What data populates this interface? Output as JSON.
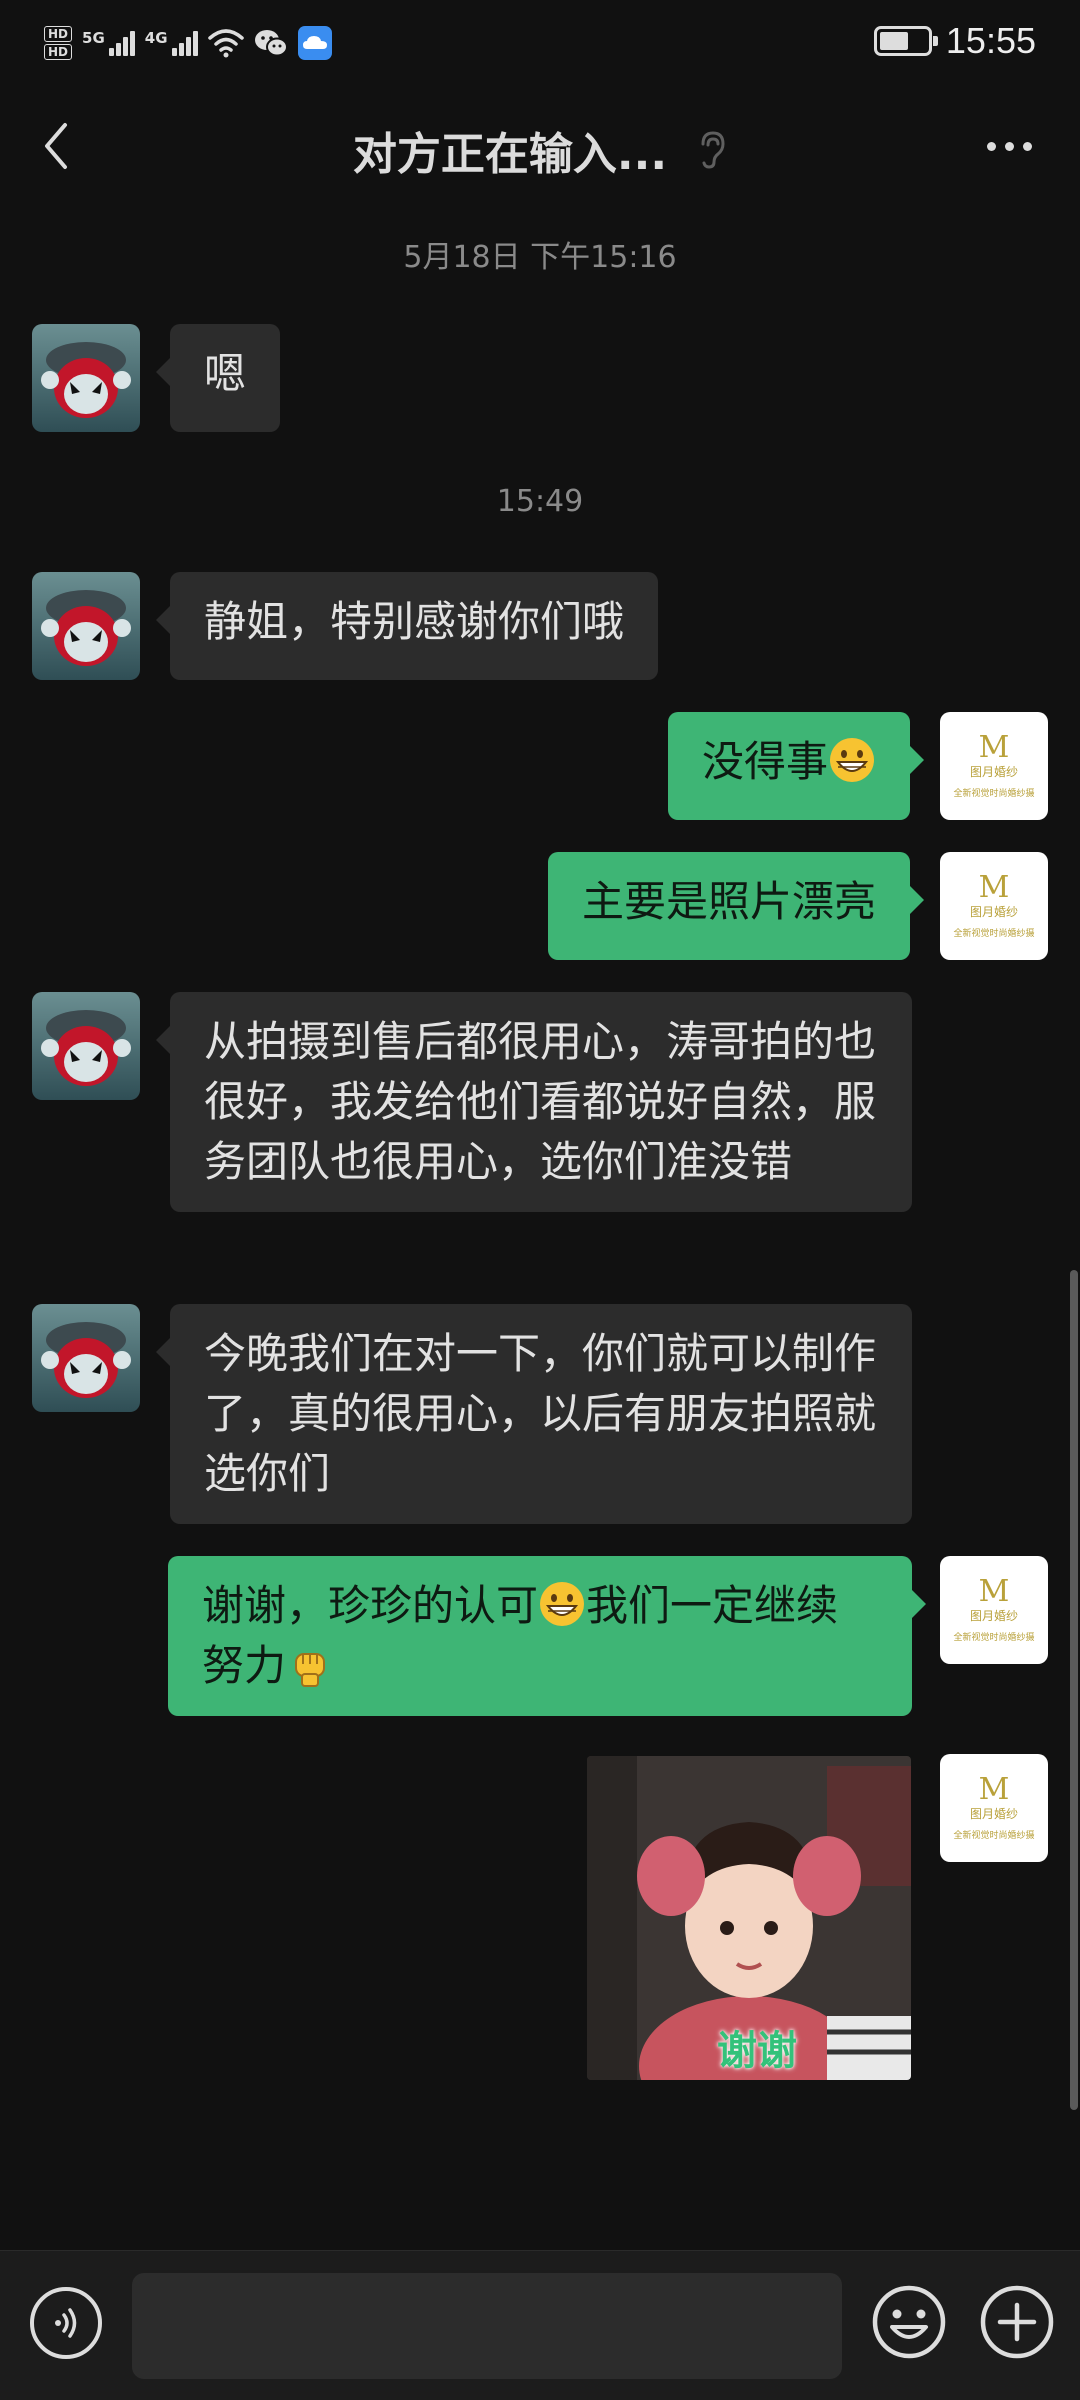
{
  "status_bar": {
    "hd_top": "HD",
    "hd_bottom": "HD",
    "net1_label": "5G",
    "net2_label": "4G",
    "time": "15:55",
    "battery_level": 0.6
  },
  "header": {
    "title": "对方正在输入..."
  },
  "chat": {
    "timestamp_1": "5月18日 下午15:16",
    "timestamp_2": "15:49",
    "messages": [
      {
        "side": "in",
        "text": "嗯"
      },
      {
        "side": "in",
        "text": "静姐，特别感谢你们哦"
      },
      {
        "side": "out",
        "text": "没得事",
        "emoji": "grinning-face"
      },
      {
        "side": "out",
        "text": "主要是照片漂亮"
      },
      {
        "side": "in",
        "text": "从拍摄到售后都很用心，涛哥拍的也很好，我发给他们看都说好自然，服务团队也很用心，选你们准没错"
      },
      {
        "side": "in",
        "text": "今晚我们在对一下，你们就可以制作了，真的很用心，以后有朋友拍照就选你们"
      },
      {
        "side": "out",
        "text_a": "谢谢，珍珍的认可",
        "emoji_a": "grinning-face",
        "text_b": "我们一定继续努力",
        "emoji_b": "raised-fist"
      },
      {
        "side": "out",
        "type": "sticker",
        "caption": "谢谢"
      }
    ]
  },
  "avatars": {
    "self_logo_text": "M",
    "self_brand": "图月婚纱",
    "self_tagline": "全新视觉时尚婚纱摄"
  },
  "colors": {
    "background": "#111111",
    "bubble_in": "#2c2c2c",
    "bubble_out": "#3eb575"
  }
}
